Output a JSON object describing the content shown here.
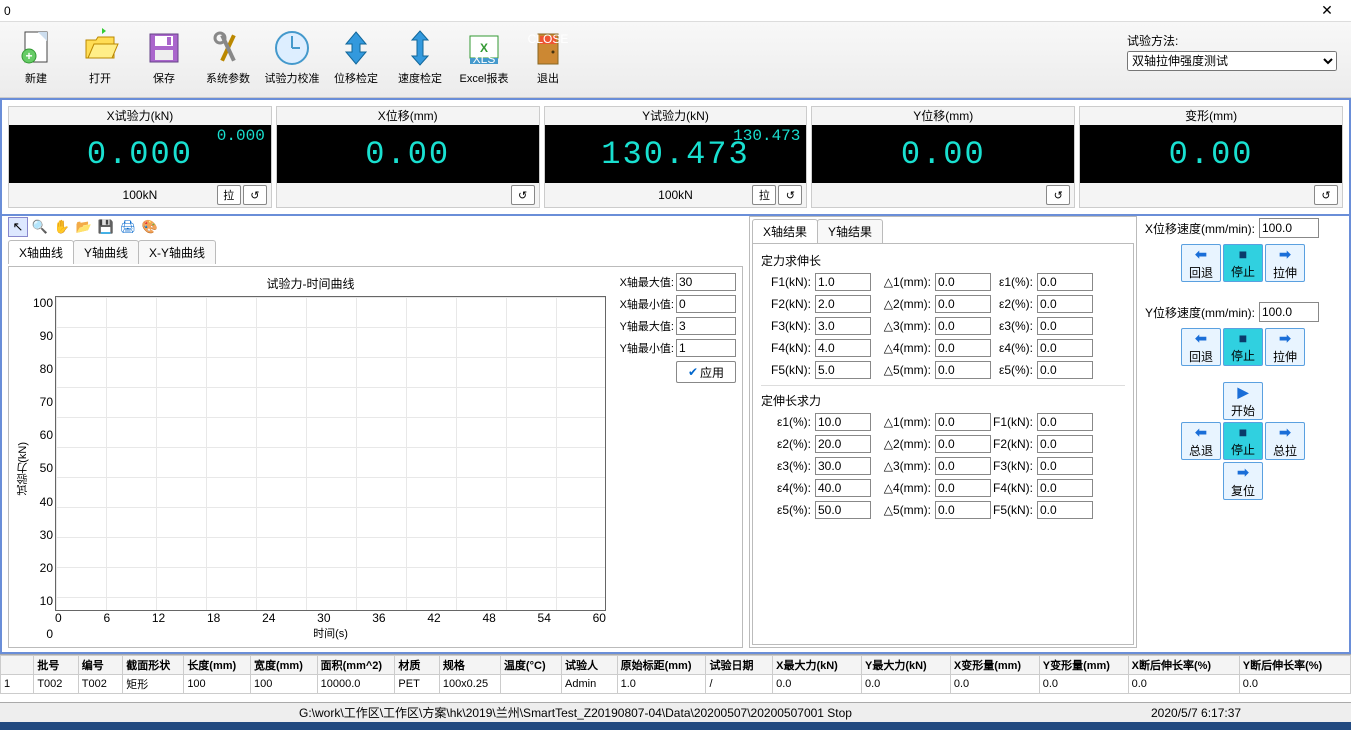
{
  "title": "0",
  "toolbar": {
    "new": "新建",
    "open": "打开",
    "save": "保存",
    "sysparam": "系统参数",
    "calibforce": "试验力校准",
    "calibdisp": "位移检定",
    "calibspeed": "速度检定",
    "excel": "Excel报表",
    "exit": "退出"
  },
  "method": {
    "label": "试验方法:",
    "selected": "双轴拉伸强度测试"
  },
  "readouts": [
    {
      "label": "X试验力(kN)",
      "big": "0.000",
      "small": "0.000",
      "cap": "100kN",
      "btns": [
        "拉",
        "↺"
      ]
    },
    {
      "label": "X位移(mm)",
      "big": "0.00",
      "small": "",
      "cap": "",
      "btns": [
        "↺"
      ]
    },
    {
      "label": "Y试验力(kN)",
      "big": "130.473",
      "small": "130.473",
      "cap": "100kN",
      "btns": [
        "拉",
        "↺"
      ]
    },
    {
      "label": "Y位移(mm)",
      "big": "0.00",
      "small": "",
      "cap": "",
      "btns": [
        "↺"
      ]
    },
    {
      "label": "变形(mm)",
      "big": "0.00",
      "small": "",
      "cap": "",
      "btns": [
        "↺"
      ]
    }
  ],
  "chartTabs": [
    "X轴曲线",
    "Y轴曲线",
    "X-Y轴曲线"
  ],
  "chart_data": {
    "type": "line",
    "title": "试验力-时间曲线",
    "xlabel": "时间(s)",
    "ylabel": "试验力(kN)",
    "x_ticks": [
      "0",
      "6",
      "12",
      "18",
      "24",
      "30",
      "36",
      "42",
      "48",
      "54",
      "60"
    ],
    "y_ticks": [
      "100",
      "90",
      "80",
      "70",
      "60",
      "50",
      "40",
      "30",
      "20",
      "10",
      "0"
    ],
    "xlim": [
      0,
      60
    ],
    "ylim": [
      0,
      100
    ],
    "series": []
  },
  "axis": {
    "xmax_l": "X轴最大值:",
    "xmax": "30",
    "xmin_l": "X轴最小值:",
    "xmin": "0",
    "ymax_l": "Y轴最大值:",
    "ymax": "3",
    "ymin_l": "Y轴最小值:",
    "ymin": "1",
    "apply": "应用"
  },
  "midTabs": [
    "X轴结果",
    "Y轴结果"
  ],
  "sectA_title": "定力求伸长",
  "sectA": {
    "rows": [
      {
        "f_l": "F1(kN):",
        "f": "1.0",
        "d_l": "△1(mm):",
        "d": "0.0",
        "e_l": "ε1(%):",
        "e": "0.0"
      },
      {
        "f_l": "F2(kN):",
        "f": "2.0",
        "d_l": "△2(mm):",
        "d": "0.0",
        "e_l": "ε2(%):",
        "e": "0.0"
      },
      {
        "f_l": "F3(kN):",
        "f": "3.0",
        "d_l": "△3(mm):",
        "d": "0.0",
        "e_l": "ε3(%):",
        "e": "0.0"
      },
      {
        "f_l": "F4(kN):",
        "f": "4.0",
        "d_l": "△4(mm):",
        "d": "0.0",
        "e_l": "ε4(%):",
        "e": "0.0"
      },
      {
        "f_l": "F5(kN):",
        "f": "5.0",
        "d_l": "△5(mm):",
        "d": "0.0",
        "e_l": "ε5(%):",
        "e": "0.0"
      }
    ]
  },
  "sectB_title": "定伸长求力",
  "sectB": {
    "rows": [
      {
        "e_l": "ε1(%):",
        "e": "10.0",
        "d_l": "△1(mm):",
        "d": "0.0",
        "f_l": "F1(kN):",
        "f": "0.0"
      },
      {
        "e_l": "ε2(%):",
        "e": "20.0",
        "d_l": "△2(mm):",
        "d": "0.0",
        "f_l": "F2(kN):",
        "f": "0.0"
      },
      {
        "e_l": "ε3(%):",
        "e": "30.0",
        "d_l": "△3(mm):",
        "d": "0.0",
        "f_l": "F3(kN):",
        "f": "0.0"
      },
      {
        "e_l": "ε4(%):",
        "e": "40.0",
        "d_l": "△4(mm):",
        "d": "0.0",
        "f_l": "F4(kN):",
        "f": "0.0"
      },
      {
        "e_l": "ε5(%):",
        "e": "50.0",
        "d_l": "△5(mm):",
        "d": "0.0",
        "f_l": "F5(kN):",
        "f": "0.0"
      }
    ]
  },
  "right": {
    "xspeed_l": "X位移速度(mm/min):",
    "xspeed": "100.0",
    "yspeed_l": "Y位移速度(mm/min):",
    "yspeed": "100.0",
    "back": "回退",
    "stop": "停止",
    "fwd": "拉伸",
    "start": "开始",
    "allback": "总退",
    "allstop": "停止",
    "allfwd": "总拉",
    "reset": "复位"
  },
  "table": {
    "headers": [
      "",
      "批号",
      "编号",
      "截面形状",
      "长度(mm)",
      "宽度(mm)",
      "面积(mm^2)",
      "材质",
      "规格",
      "温度(°C)",
      "试验人",
      "原始标距(mm)",
      "试验日期",
      "X最大力(kN)",
      "Y最大力(kN)",
      "X变形量(mm)",
      "Y变形量(mm)",
      "X断后伸长率(%)",
      "Y断后伸长率(%)"
    ],
    "row": [
      "1",
      "T002",
      "T002",
      "矩形",
      "100",
      "100",
      "10000.0",
      "PET",
      "100x0.25",
      "",
      "Admin",
      "1.0",
      "/",
      "0.0",
      "0.0",
      "0.0",
      "0.0",
      "0.0",
      "0.0"
    ]
  },
  "status": {
    "path": "G:\\work\\工作区\\工作区\\方案\\hk\\2019\\兰州\\SmartTest_Z20190807-04\\Data\\20200507\\20200507001 Stop",
    "time": "2020/5/7 6:17:37"
  }
}
